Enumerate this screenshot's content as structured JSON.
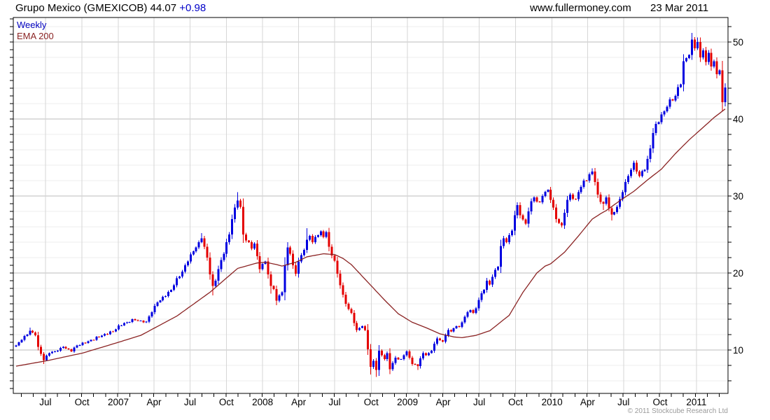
{
  "header": {
    "title": "Grupo Mexico (GMEXICOB) 44.07",
    "change": "+0.98",
    "site": "www.fullermoney.com",
    "date": "23 Mar 2011"
  },
  "legend": {
    "weekly": "Weekly",
    "ema": "EMA 200"
  },
  "footer": {
    "copyright": "© 2011 Stockcube Research Ltd"
  },
  "chart_data": {
    "type": "candlestick",
    "title": "Grupo Mexico (GMEXICOB) weekly candlestick chart with 200-period EMA",
    "timeframe": "Weekly",
    "last_close": 44.07,
    "weeks_total": 257,
    "first_week_approx": "2006-04-24",
    "ylim": [
      4.4,
      53.2
    ],
    "y_major_ticks": [
      10,
      20,
      30,
      40,
      50
    ],
    "y_minor_step": 2,
    "legend_position": "top-left",
    "grid": true,
    "colors": {
      "up": "#0000e0",
      "down": "#e40000",
      "ema": "#8b2424",
      "grid_minor_h": "#ededed",
      "grid_major_h": "#bdbdbd",
      "grid_vert": "#d6d6d6",
      "axis": "#000000"
    },
    "x_ticks": [
      {
        "label": "Jul",
        "week": 10.6
      },
      {
        "label": "Oct",
        "week": 23.8
      },
      {
        "label": "2007",
        "week": 36.9
      },
      {
        "label": "Apr",
        "week": 49.8
      },
      {
        "label": "Jul",
        "week": 62.8
      },
      {
        "label": "Oct",
        "week": 75.9
      },
      {
        "label": "2008",
        "week": 89.0
      },
      {
        "label": "Apr",
        "week": 102.0
      },
      {
        "label": "Jul",
        "week": 115.0
      },
      {
        "label": "Oct",
        "week": 128.2
      },
      {
        "label": "2009",
        "week": 141.3
      },
      {
        "label": "Apr",
        "week": 154.2
      },
      {
        "label": "Jul",
        "week": 167.2
      },
      {
        "label": "Oct",
        "week": 180.3
      },
      {
        "label": "2010",
        "week": 193.5
      },
      {
        "label": "Apr",
        "week": 206.3
      },
      {
        "label": "Jul",
        "week": 219.3
      },
      {
        "label": "Oct",
        "week": 232.5
      },
      {
        "label": "2011",
        "week": 245.6
      }
    ],
    "month_tick_start_week": 1.9,
    "month_tick_step_weeks": 4.345,
    "price_anchors_format": [
      "week_index",
      "close",
      "high_or_null",
      "low_or_null"
    ],
    "price_anchors": [
      [
        0,
        10.6
      ],
      [
        3,
        11.8
      ],
      [
        5,
        12.5,
        12.9,
        null
      ],
      [
        7,
        11.9
      ],
      [
        8,
        10.4
      ],
      [
        10,
        8.7,
        null,
        8.2
      ],
      [
        12,
        9.6
      ],
      [
        15,
        9.9
      ],
      [
        17,
        10.4
      ],
      [
        20,
        9.8
      ],
      [
        22,
        10.6
      ],
      [
        25,
        10.9
      ],
      [
        27,
        11.3
      ],
      [
        30,
        11.7
      ],
      [
        32,
        12.1
      ],
      [
        35,
        12.4
      ],
      [
        37,
        13.2
      ],
      [
        40,
        13.6
      ],
      [
        42,
        14.0
      ],
      [
        45,
        13.8
      ],
      [
        47,
        13.7
      ],
      [
        49,
        14.9
      ],
      [
        51,
        16.2
      ],
      [
        54,
        17.0
      ],
      [
        56,
        17.8
      ],
      [
        58,
        19.3
      ],
      [
        60,
        20.2
      ],
      [
        62,
        21.5
      ],
      [
        64,
        22.8
      ],
      [
        66,
        24.0
      ],
      [
        67,
        24.5,
        25.2,
        null
      ],
      [
        69,
        22.0
      ],
      [
        70,
        19.8
      ],
      [
        71,
        18.3,
        null,
        17.1
      ],
      [
        72,
        19.0
      ],
      [
        73,
        20.5
      ],
      [
        75,
        22.5
      ],
      [
        77,
        25.0
      ],
      [
        78,
        27.0
      ],
      [
        79,
        28.5
      ],
      [
        80,
        29.4,
        30.5,
        null
      ],
      [
        81,
        28.6
      ],
      [
        82,
        25.0
      ],
      [
        84,
        24.0
      ],
      [
        85,
        23.2
      ],
      [
        86,
        23.8
      ],
      [
        87,
        22.2
      ],
      [
        88,
        20.5
      ],
      [
        90,
        21.5
      ],
      [
        91,
        19.8
      ],
      [
        92,
        18.3,
        null,
        17.3
      ],
      [
        93,
        17.9
      ],
      [
        94,
        16.4,
        null,
        15.8
      ],
      [
        96,
        17.5
      ],
      [
        97,
        21.0
      ],
      [
        98,
        23.3
      ],
      [
        99,
        22.5
      ],
      [
        100,
        21.0
      ],
      [
        101,
        19.9
      ],
      [
        102,
        21.5
      ],
      [
        104,
        23.0
      ],
      [
        105,
        24.3,
        25.8,
        null
      ],
      [
        106,
        24.8
      ],
      [
        107,
        24.0
      ],
      [
        109,
        24.9
      ],
      [
        110,
        25.4
      ],
      [
        111,
        24.7
      ],
      [
        112,
        25.3
      ],
      [
        113,
        23.4
      ],
      [
        115,
        21.6
      ],
      [
        116,
        19.9
      ],
      [
        117,
        18.4
      ],
      [
        118,
        17.2
      ],
      [
        119,
        16.0
      ],
      [
        121,
        14.8
      ],
      [
        122,
        13.5
      ],
      [
        123,
        12.6
      ],
      [
        125,
        13.1
      ],
      [
        126,
        12.6
      ],
      [
        127,
        10.1
      ],
      [
        128,
        7.8,
        null,
        6.8
      ],
      [
        129,
        8.6
      ],
      [
        130,
        7.4,
        null,
        6.5
      ],
      [
        131,
        9.9
      ],
      [
        133,
        8.8
      ],
      [
        134,
        9.6
      ],
      [
        135,
        7.5,
        null,
        6.9
      ],
      [
        136,
        8.3
      ],
      [
        137,
        9.0
      ],
      [
        139,
        8.8
      ],
      [
        140,
        9.3
      ],
      [
        141,
        9.8
      ],
      [
        142,
        9.0
      ],
      [
        143,
        8.2
      ],
      [
        145,
        7.9,
        null,
        7.4
      ],
      [
        146,
        8.9
      ],
      [
        147,
        9.6
      ],
      [
        148,
        9.3
      ],
      [
        150,
        9.9
      ],
      [
        151,
        10.8
      ],
      [
        152,
        11.5
      ],
      [
        154,
        11.1
      ],
      [
        155,
        11.9
      ],
      [
        156,
        12.6
      ],
      [
        157,
        12.4
      ],
      [
        159,
        13.1
      ],
      [
        160,
        13.0
      ],
      [
        161,
        13.6
      ],
      [
        162,
        14.3
      ],
      [
        164,
        15.2
      ],
      [
        165,
        14.8
      ],
      [
        166,
        15.4
      ],
      [
        167,
        16.5
      ],
      [
        169,
        17.8
      ],
      [
        170,
        19.0
      ],
      [
        171,
        18.5
      ],
      [
        172,
        19.5
      ],
      [
        174,
        20.8
      ],
      [
        175,
        23.5
      ],
      [
        176,
        24.5
      ],
      [
        177,
        24.0
      ],
      [
        179,
        25.5
      ],
      [
        180,
        27.5
      ],
      [
        181,
        28.8
      ],
      [
        182,
        27.5
      ],
      [
        184,
        26.4
      ],
      [
        185,
        28.0
      ],
      [
        186,
        29.3
      ],
      [
        187,
        29.8
      ],
      [
        189,
        29.2
      ],
      [
        190,
        30.0
      ],
      [
        192,
        30.8
      ],
      [
        193,
        29.5
      ],
      [
        194,
        28.5
      ],
      [
        195,
        27.0
      ],
      [
        197,
        26.2,
        null,
        25.9
      ],
      [
        198,
        27.8
      ],
      [
        199,
        29.5
      ],
      [
        200,
        30.2
      ],
      [
        202,
        29.6
      ],
      [
        203,
        30.5
      ],
      [
        204,
        31.2
      ],
      [
        205,
        32.0
      ],
      [
        207,
        32.8
      ],
      [
        208,
        33.2,
        33.6,
        null
      ],
      [
        209,
        31.8
      ],
      [
        210,
        30.2
      ],
      [
        212,
        29.0,
        null,
        28.2
      ],
      [
        213,
        29.8
      ],
      [
        214,
        28.4
      ],
      [
        215,
        27.6,
        null,
        26.8
      ],
      [
        217,
        28.6
      ],
      [
        218,
        29.6
      ],
      [
        219,
        30.5
      ],
      [
        220,
        31.8
      ],
      [
        222,
        33.4
      ],
      [
        223,
        34.3
      ],
      [
        224,
        33.2
      ],
      [
        225,
        32.6
      ],
      [
        227,
        33.4
      ],
      [
        228,
        34.8
      ],
      [
        229,
        36.2
      ],
      [
        230,
        38.2
      ],
      [
        232,
        39.6
      ],
      [
        233,
        40.6
      ],
      [
        234,
        41.0,
        null,
        40.3
      ],
      [
        235,
        41.6
      ],
      [
        237,
        42.4
      ],
      [
        238,
        43.0
      ],
      [
        240,
        44.5
      ],
      [
        241,
        47.5
      ],
      [
        242,
        47.9
      ],
      [
        243,
        48.3
      ],
      [
        244,
        50.3,
        51.2,
        null
      ],
      [
        245,
        49.2
      ],
      [
        246,
        50.0,
        50.6,
        null
      ],
      [
        247,
        48.0
      ],
      [
        248,
        48.9
      ],
      [
        249,
        47.4
      ],
      [
        250,
        48.6
      ],
      [
        251,
        46.8
      ],
      [
        252,
        47.5
      ],
      [
        253,
        45.8
      ],
      [
        254,
        46.3
      ],
      [
        255,
        42.2,
        null,
        41.5
      ],
      [
        256,
        44.07,
        44.3,
        41.8
      ]
    ],
    "ema_anchors_format": [
      "week_index",
      "value"
    ],
    "ema_anchors": [
      [
        0,
        7.9
      ],
      [
        11,
        8.6
      ],
      [
        24,
        9.6
      ],
      [
        36,
        10.9
      ],
      [
        45,
        11.9
      ],
      [
        58,
        14.4
      ],
      [
        70,
        17.5
      ],
      [
        80,
        20.6
      ],
      [
        87,
        21.3
      ],
      [
        90,
        21.4
      ],
      [
        94,
        21.1
      ],
      [
        96,
        20.9
      ],
      [
        101,
        21.4
      ],
      [
        105,
        22.1
      ],
      [
        111,
        22.5
      ],
      [
        115,
        22.4
      ],
      [
        118,
        21.9
      ],
      [
        121,
        21.1
      ],
      [
        127,
        18.8
      ],
      [
        133,
        16.5
      ],
      [
        138,
        14.7
      ],
      [
        143,
        13.6
      ],
      [
        148,
        12.9
      ],
      [
        153,
        12.1
      ],
      [
        158,
        11.7
      ],
      [
        161,
        11.6
      ],
      [
        166,
        11.9
      ],
      [
        171,
        12.5
      ],
      [
        178,
        14.5
      ],
      [
        183,
        17.5
      ],
      [
        188,
        20.0
      ],
      [
        191,
        20.9
      ],
      [
        193,
        21.2
      ],
      [
        198,
        22.7
      ],
      [
        203,
        24.8
      ],
      [
        208,
        27.0
      ],
      [
        211,
        27.7
      ],
      [
        213,
        28.1
      ],
      [
        218,
        29.4
      ],
      [
        223,
        30.6
      ],
      [
        228,
        32.1
      ],
      [
        233,
        33.5
      ],
      [
        238,
        35.5
      ],
      [
        243,
        37.3
      ],
      [
        248,
        38.9
      ],
      [
        252,
        40.2
      ],
      [
        256,
        41.3
      ]
    ]
  }
}
